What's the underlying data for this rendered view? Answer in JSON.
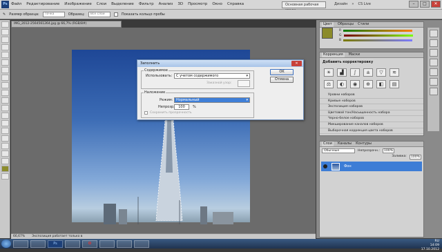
{
  "app": {
    "logo": "Ps",
    "workspace_label": "Основная рабочая среда",
    "workspace_right": "Дизайн",
    "extra": "»",
    "cs_live": "CS Live"
  },
  "menu": [
    "Файл",
    "Редактирование",
    "Изображение",
    "Слои",
    "Выделение",
    "Фильтр",
    "Анализ",
    "3D",
    "Просмотр",
    "Окно",
    "Справка"
  ],
  "options": {
    "size_label": "Размер образца:",
    "size_value": "Точка",
    "sample_label": "Образец:",
    "sample_value": "Все слои",
    "ring_label": "Показать кольцо пробы"
  },
  "document": {
    "tab": "IMG_2012-2564561264.jpg @ 66,7% (RGB/8#)",
    "zoom": "66,67%",
    "status": "Экспозиция работает только в"
  },
  "panels": {
    "color_tabs": [
      "Цвет",
      "Образцы",
      "Стили"
    ],
    "color_channels": [
      "R",
      "G",
      "B"
    ],
    "adjust_tabs": [
      "Коррекция",
      "Маски"
    ],
    "adjust_title": "Добавить корректировку",
    "adjust_items": [
      "Яркость/Контрастность",
      "Уровни",
      "Кривые",
      "Экспозиция",
      "Сочность",
      "Цветовой тон/Насыщенность"
    ],
    "adjust_list": [
      "Уровни наборов",
      "Кривые наборов",
      "Экспозиция наборов",
      "Цветовой тон/Насыщенность набора",
      "Черно-белое наборов",
      "Микширование каналов наборов",
      "Выборочная коррекция цвета наборов"
    ],
    "layers_tabs": [
      "Слои",
      "Каналы",
      "Контуры"
    ],
    "blend_mode": "Обычные",
    "opacity_label": "Непрозрачн.:",
    "opacity_value": "100%",
    "fill_label": "Заливка:",
    "fill_value": "100%",
    "layer_name": "Фон"
  },
  "dialog": {
    "title": "Заполнить",
    "close": "✕",
    "group_content": "Содержимое",
    "use_label": "Использовать:",
    "use_value": "С учетом содержимого",
    "custom_pattern": "Заказной узор:",
    "group_blending": "Наложение",
    "mode_label": "Режим:",
    "mode_value": "Нормальный",
    "opacity_label": "Непрозр.:",
    "opacity_value": "100",
    "percent": "%",
    "preserve": "Сохранить прозрачность",
    "ok": "OK",
    "cancel": "Отмена"
  },
  "taskbar": {
    "apps": [
      "",
      "",
      "Ps",
      "",
      "O",
      "",
      "",
      ""
    ],
    "time": "14:09",
    "date": "17.10.2012",
    "lang": "RU"
  },
  "icons": [
    "photoshop-logo-icon",
    "move-icon",
    "marquee-icon",
    "lasso-icon",
    "eyedropper-icon",
    "eye-icon",
    "windows-start-icon"
  ]
}
